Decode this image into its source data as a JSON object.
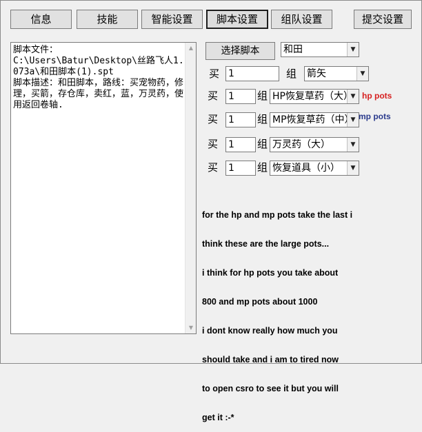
{
  "tabs": [
    {
      "label": "信息"
    },
    {
      "label": "技能"
    },
    {
      "label": "智能设置"
    },
    {
      "label": "脚本设置"
    },
    {
      "label": "组队设置"
    },
    {
      "label": "提交设置"
    }
  ],
  "script_text": "脚本文件：\nC:\\Users\\Batur\\Desktop\\丝路飞人1.073a\\和田脚本(1).spt\n脚本描述：和田脚本，路线：买宠物药，修理，买箭，存仓库，卖红，蓝，万灵药，使用返回卷轴.",
  "select_script_label": "选择脚本",
  "town_select": "和田",
  "buy_label": "买",
  "group_label": "组",
  "purchases": [
    {
      "qty": "1",
      "item": "箭矢"
    },
    {
      "qty": "1",
      "item": "HP恢复草药（大）"
    },
    {
      "qty": "1",
      "item": "MP恢复草药（中）"
    },
    {
      "qty": "1",
      "item": "万灵药（大）"
    },
    {
      "qty": "1",
      "item": "恢复道具（小）"
    }
  ],
  "annotations": {
    "hp": "hp pots",
    "mp": "mp pots",
    "hp_color": "#d62020",
    "mp_color": "#2a3a8c"
  },
  "note_lines": [
    "for the hp and mp pots take the last i",
    "think these are the large pots...",
    "i think for hp pots you take about",
    "800 and mp pots about 1000",
    "i dont know really how much you",
    "should take and i am to tired now",
    "to open csro to see it but you will",
    "get it :-*"
  ]
}
